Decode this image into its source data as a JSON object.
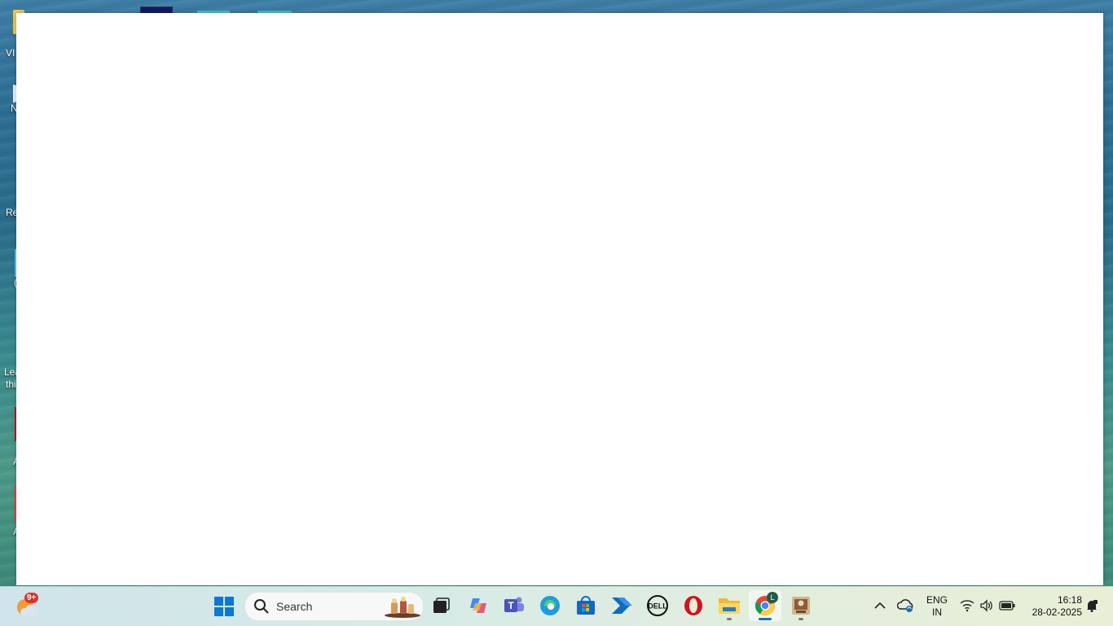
{
  "desktop": {
    "icons": [
      {
        "label": "VI"
      },
      {
        "label": "N"
      },
      {
        "label": "Re"
      },
      {
        "label": "("
      },
      {
        "label": "Lea"
      },
      {
        "label": "thi"
      },
      {
        "label": "A"
      },
      {
        "label": "A"
      }
    ]
  },
  "taskbar": {
    "weather_badge": "9+",
    "search_label": "Search",
    "apps": [
      {
        "name": "start",
        "icon": "windows-logo-icon"
      },
      {
        "name": "task-view",
        "icon": "task-view-icon"
      },
      {
        "name": "copilot",
        "icon": "copilot-icon"
      },
      {
        "name": "teams",
        "icon": "teams-icon"
      },
      {
        "name": "edge",
        "icon": "edge-icon"
      },
      {
        "name": "microsoft-store",
        "icon": "store-icon"
      },
      {
        "name": "power-automate",
        "icon": "power-automate-icon"
      },
      {
        "name": "dell",
        "icon": "dell-icon"
      },
      {
        "name": "opera",
        "icon": "opera-icon"
      },
      {
        "name": "file-explorer",
        "icon": "folder-icon"
      },
      {
        "name": "chrome",
        "icon": "chrome-icon",
        "badge": "L"
      },
      {
        "name": "app",
        "icon": "app-icon"
      }
    ],
    "tray": {
      "language_top": "ENG",
      "language_bottom": "IN",
      "time": "16:18",
      "date": "28-02-2025"
    },
    "colors": {
      "windows_blue": "#0a78d4",
      "chrome_indicator": "#1a6fb8",
      "opera_red": "#d4111e"
    }
  }
}
